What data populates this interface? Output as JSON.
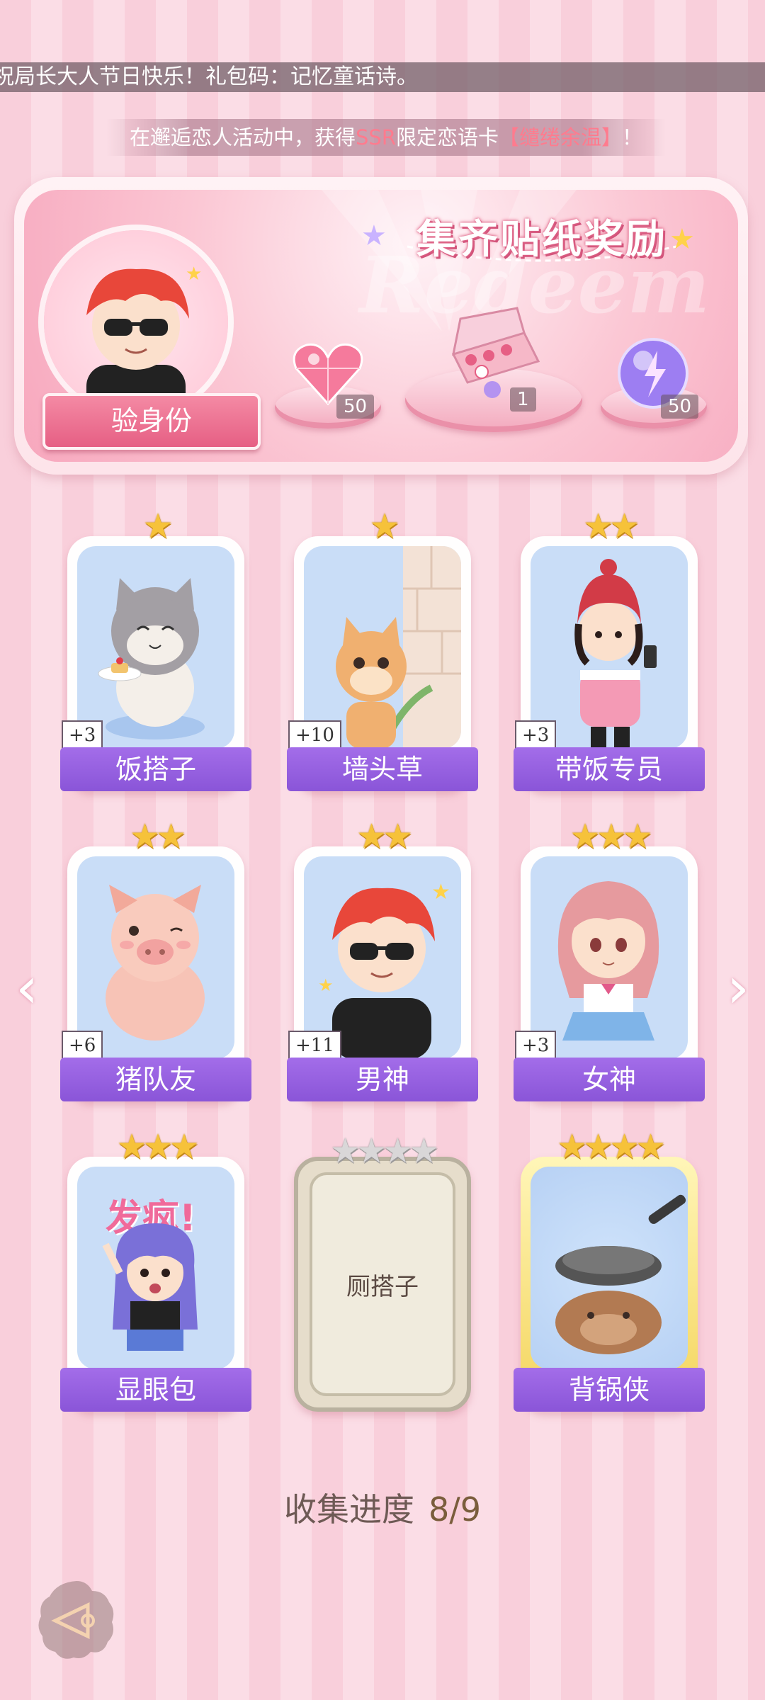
{
  "marquee": {
    "text": "祝局长大人节日快乐！礼包码：记忆童话诗。"
  },
  "notice": {
    "prefix": "在邂逅恋人活动中，获得",
    "highlight1": "SSR",
    "middle": "限定恋语卡",
    "highlight2": "【缱绻余温】",
    "suffix": "！"
  },
  "banner": {
    "title": "集齐贴纸奖励",
    "ghost_text": "Redeem",
    "verify_button": "验身份",
    "rewards": [
      {
        "icon": "heart-gem-icon",
        "count": "50"
      },
      {
        "icon": "gift-box-icon",
        "count": "1"
      },
      {
        "icon": "energy-orb-icon",
        "count": "50"
      }
    ]
  },
  "cards": [
    {
      "name": "饭搭子",
      "stars": "★",
      "bonus": "+3",
      "art": "cat-with-cake"
    },
    {
      "name": "墙头草",
      "stars": "★",
      "bonus": "+10",
      "art": "squirrel-behind-wall"
    },
    {
      "name": "带饭专员",
      "stars": "★★",
      "bonus": "+3",
      "art": "girl-with-phone"
    },
    {
      "name": "猪队友",
      "stars": "★★",
      "bonus": "+6",
      "art": "pig"
    },
    {
      "name": "男神",
      "stars": "★★",
      "bonus": "+11",
      "art": "boy-sunglasses"
    },
    {
      "name": "女神",
      "stars": "★★★",
      "bonus": "+3",
      "art": "girl-pink-hair"
    },
    {
      "name": "显眼包",
      "stars": "★★★",
      "bonus": "",
      "art": "girl-shouting",
      "art_text": "发疯!"
    },
    {
      "name": "厕搭子",
      "stars": "★★★★",
      "bonus": "",
      "art": "locked"
    },
    {
      "name": "背锅侠",
      "stars": "★★★★",
      "bonus": "",
      "art": "capybara-with-pan"
    }
  ],
  "progress": {
    "label": "收集进度",
    "value": "8/9",
    "collected": 8,
    "total": 9
  },
  "colors": {
    "card_label": "#8a55d8",
    "star": "#f6c23a",
    "highlight": "#ff7b8e"
  }
}
